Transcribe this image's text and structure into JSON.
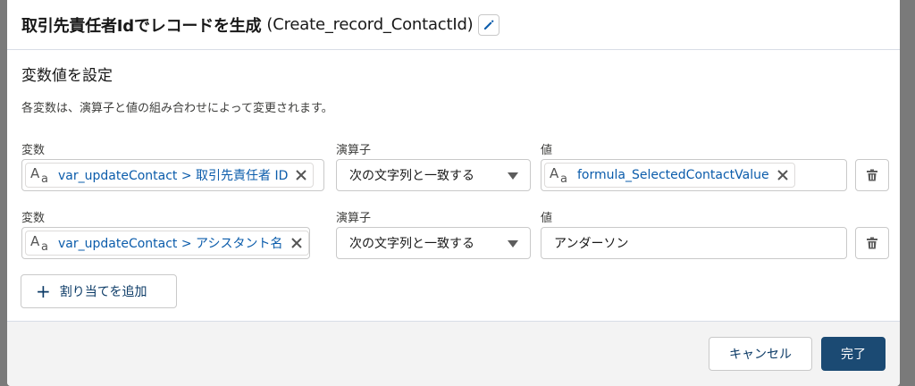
{
  "header": {
    "title": "取引先責任者Idでレコードを生成",
    "api_name": "(Create_record_ContactId)"
  },
  "section": {
    "title": "変数値を設定",
    "help": "各変数は、演算子と値の組み合わせによって変更されます。"
  },
  "rows": [
    {
      "variable_label": "変数",
      "variable_value": "var_updateContact > 取引先責任者 ID",
      "operator_label": "演算子",
      "operator_value": "次の文字列と一致する",
      "value_label": "値",
      "value_value": "formula_SelectedContactValue",
      "value_is_resource": true
    },
    {
      "variable_label": "変数",
      "variable_value": "var_updateContact > アシスタント名",
      "operator_label": "演算子",
      "operator_value": "次の文字列と一致する",
      "value_label": "値",
      "value_value": "アンダーソン",
      "value_is_resource": false
    }
  ],
  "add_button": {
    "label": "割り当てを追加"
  },
  "footer": {
    "cancel_label": "キャンセル",
    "done_label": "完了"
  },
  "icons": {
    "edit": "pencil-icon",
    "text_type": "text-type-icon",
    "remove": "close-icon",
    "delete": "trash-icon",
    "add": "plus-icon",
    "dropdown": "caret-down-icon"
  },
  "colors": {
    "link": "#0b5cab",
    "primary_button": "#1b4a73",
    "border": "#c9c9c9",
    "footer_bg": "#f3f3f3"
  }
}
